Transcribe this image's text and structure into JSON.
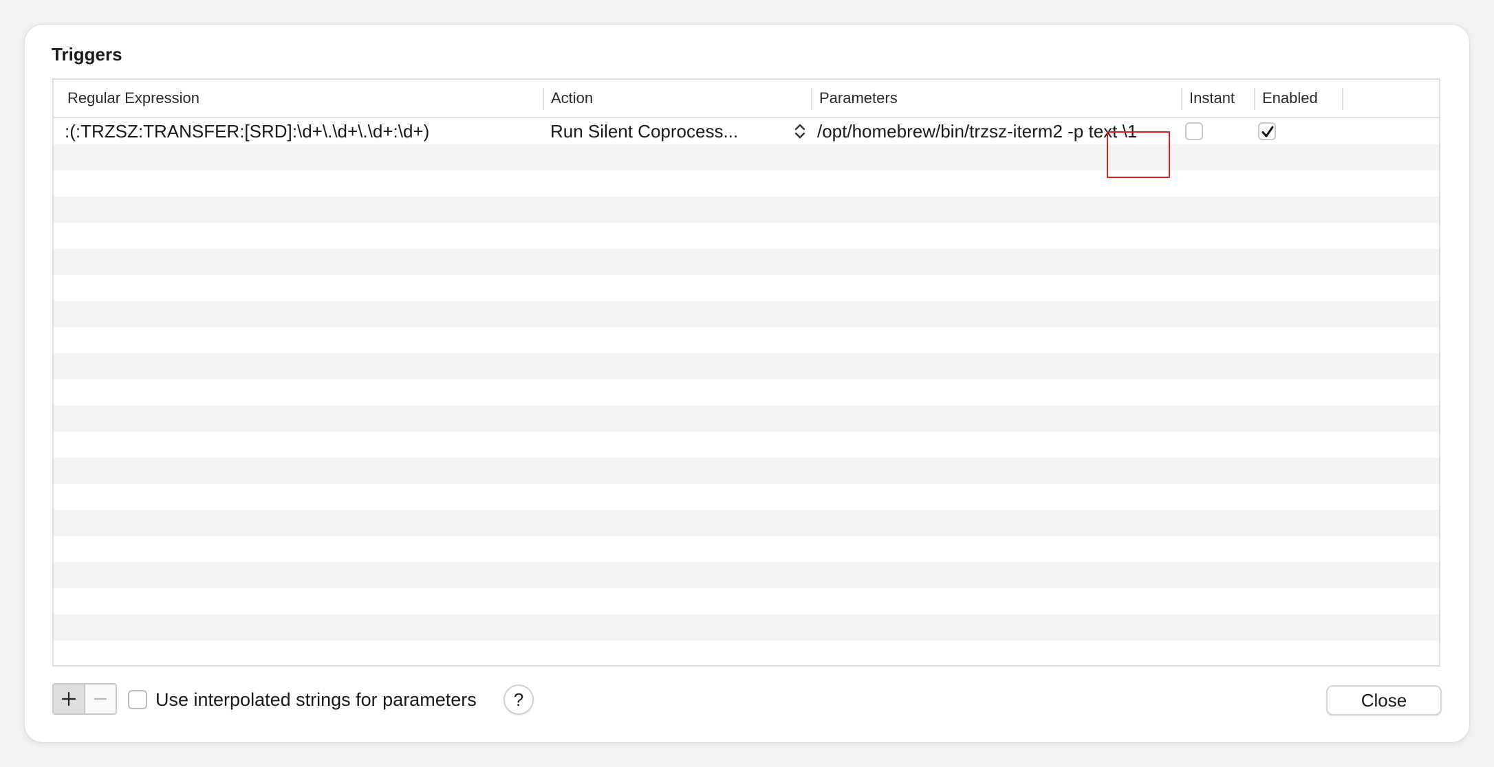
{
  "sheet": {
    "title": "Triggers"
  },
  "table": {
    "columns": [
      {
        "label": "Regular Expression"
      },
      {
        "label": "Action"
      },
      {
        "label": "Parameters"
      },
      {
        "label": "Instant"
      },
      {
        "label": "Enabled"
      }
    ],
    "rows": [
      {
        "regex": ":(:TRZSZ:TRANSFER:[SRD]:\\d+\\.\\d+\\.\\d+:\\d+)",
        "action": "Run Silent Coprocess...",
        "parameters": "/opt/homebrew/bin/trzsz-iterm2 -p text \\1",
        "instant": false,
        "enabled": true
      }
    ]
  },
  "footer": {
    "add_label": "+",
    "remove_label": "—",
    "interpolated_label": "Use interpolated strings for parameters",
    "interpolated_checked": false,
    "help_label": "?",
    "close_label": "Close"
  },
  "colors": {
    "highlight_border": "#e0201e",
    "row_alt": "#f4f4f4"
  },
  "icons": {
    "action_popup": "updown-chevron-icon",
    "enabled_check": "checkmark-icon"
  }
}
